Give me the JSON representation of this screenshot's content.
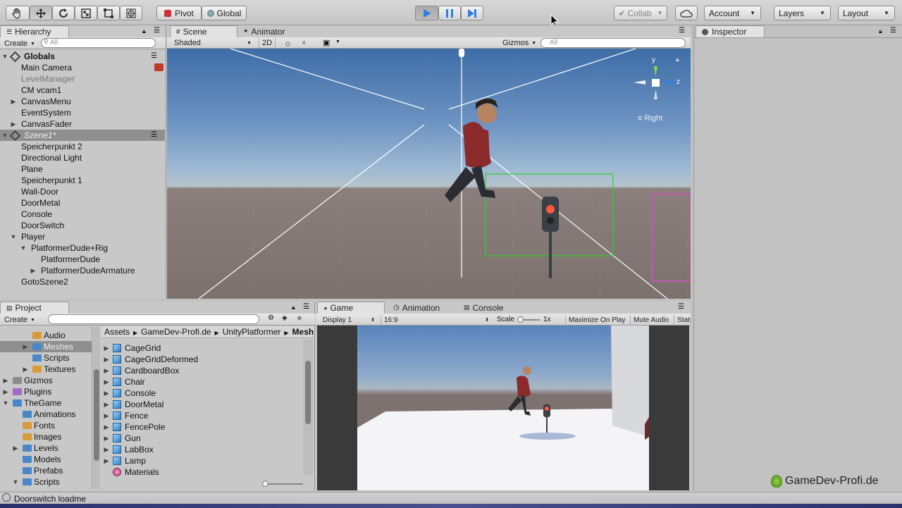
{
  "toolbar": {
    "tools": [
      "hand-icon",
      "move-icon",
      "rotate-icon",
      "scale-icon",
      "rect-tool-icon",
      "transform-icon"
    ],
    "pivot": "Pivot",
    "global": "Global",
    "collab": "Collab",
    "account": "Account",
    "layers": "Layers",
    "layout": "Layout"
  },
  "hierarchy": {
    "tab": "Hierarchy",
    "create": "Create",
    "search_placeholder": "All",
    "items": [
      {
        "label": "Globals",
        "scene": true
      },
      {
        "label": "Main Camera"
      },
      {
        "label": "LevelManager",
        "inactive": true
      },
      {
        "label": "CM vcam1"
      },
      {
        "label": "CanvasMenu",
        "expandable": true
      },
      {
        "label": "EventSystem"
      },
      {
        "label": "CanvasFader",
        "expandable": true
      },
      {
        "label": "Szene1*",
        "scene": true,
        "selected": true
      },
      {
        "label": "Speicherpunkt 2"
      },
      {
        "label": "Directional Light"
      },
      {
        "label": "Plane"
      },
      {
        "label": "Speicherpunkt 1"
      },
      {
        "label": "Wall-Door"
      },
      {
        "label": "DoorMetal"
      },
      {
        "label": "Console"
      },
      {
        "label": "DoorSwitch"
      },
      {
        "label": "Player",
        "expanded": true
      },
      {
        "label": "PlatformerDude+Rig",
        "expanded": true
      },
      {
        "label": "PlatformerDude"
      },
      {
        "label": "PlatformerDudeArmature",
        "expandable": true
      },
      {
        "label": "GotoSzene2"
      }
    ]
  },
  "scene": {
    "tab": "Scene",
    "animator_tab": "Animator",
    "shading": "Shaded",
    "twod": "2D",
    "gizmos": "Gizmos",
    "search_placeholder": "All",
    "axes": {
      "y": "y",
      "z": "z"
    },
    "view_label": "Right"
  },
  "inspector": {
    "tab": "Inspector"
  },
  "project": {
    "tab": "Project",
    "create": "Create",
    "folders": [
      {
        "label": "Audio"
      },
      {
        "label": "Meshes",
        "selected": true
      },
      {
        "label": "Scripts"
      },
      {
        "label": "Textures"
      },
      {
        "label": "Gizmos"
      },
      {
        "label": "Plugins"
      },
      {
        "label": "TheGame"
      },
      {
        "label": "Animations"
      },
      {
        "label": "Fonts"
      },
      {
        "label": "Images"
      },
      {
        "label": "Levels"
      },
      {
        "label": "Models"
      },
      {
        "label": "Prefabs"
      },
      {
        "label": "Scripts"
      }
    ],
    "breadcrumb": [
      "Assets",
      "GameDev-Profi.de",
      "UnityPlatformer",
      "Mesh"
    ],
    "assets": [
      "CageGrid",
      "CageGridDeformed",
      "CardboardBox",
      "Chair",
      "Console",
      "DoorMetal",
      "Fence",
      "FencePole",
      "Gun",
      "LabBox",
      "Lamp",
      "Materials"
    ]
  },
  "game": {
    "tab": "Game",
    "animation_tab": "Animation",
    "console_tab": "Console",
    "display": "Display 1",
    "aspect": "16:9",
    "scale_label": "Scale",
    "scale_value": "1x",
    "maximize": "Maximize On Play",
    "mute": "Mute Audio",
    "stats": "Stats"
  },
  "status": {
    "text": "Doorswitch loadme"
  },
  "watermark": "GameDev-Profi.de"
}
